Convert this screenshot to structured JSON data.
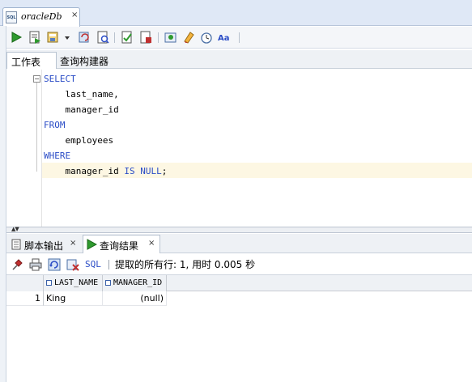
{
  "document_tab": {
    "icon_text": "SQL",
    "title": "oracleDb",
    "close": "×"
  },
  "toolbar": {
    "icons": [
      "run-statement-icon",
      "run-script-icon",
      "commit-icon",
      "dropdown-arrow-icon",
      "rollback-icon",
      "explain-plan-icon",
      "autotrace-icon",
      "sql-tuning-icon",
      "unshared-sql-icon",
      "clear-icon",
      "history-icon",
      "format-icon"
    ]
  },
  "subtabs": {
    "worksheet": "工作表",
    "query_builder": "查询构建器"
  },
  "editor": {
    "fold_marker": "⊟",
    "lines": [
      {
        "text": "SELECT",
        "type": "keyword"
      },
      {
        "text": "    last_name,",
        "type": "plain"
      },
      {
        "text": "    manager_id",
        "type": "plain"
      },
      {
        "text": "FROM",
        "type": "keyword"
      },
      {
        "text": "    employees",
        "type": "plain"
      },
      {
        "text": "WHERE",
        "type": "keyword"
      }
    ],
    "last_line": {
      "indent": "    ",
      "column": "manager_id",
      "kw": "IS NULL",
      "end": ";"
    }
  },
  "splitter": {
    "arrows": "▲▼"
  },
  "bottom_tabs": {
    "script_output": "脚本输出",
    "query_result": "查询结果",
    "close": "×"
  },
  "result_toolbar": {
    "sql_label": "SQL",
    "status": "提取的所有行: 1, 用时 0.005 秒"
  },
  "grid": {
    "columns": [
      "LAST_NAME",
      "MANAGER_ID"
    ],
    "rows": [
      {
        "num": "1",
        "last_name": "King",
        "manager_id": "(null)"
      }
    ]
  },
  "colors": {
    "keyword": "#2a4cc6",
    "current_line": "#fdf7e3",
    "run_green": "#2e9a2e"
  }
}
